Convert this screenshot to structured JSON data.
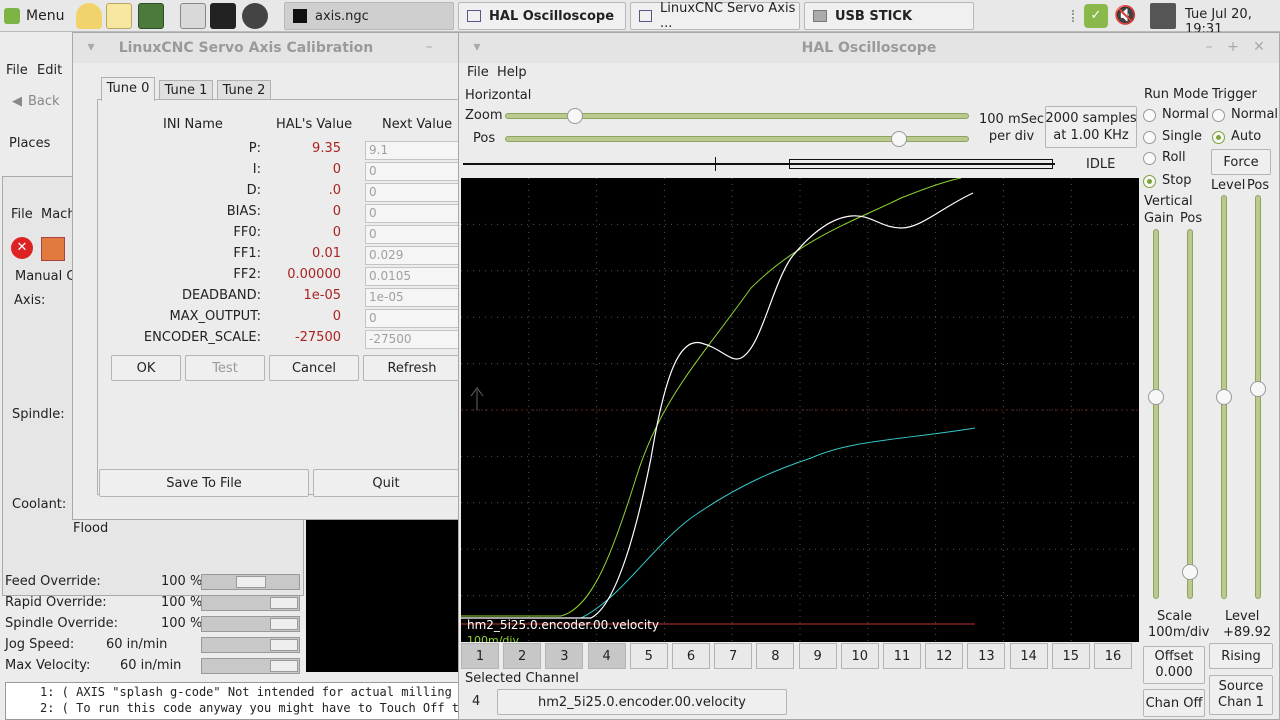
{
  "taskbar": {
    "menu_label": "Menu",
    "tasks": [
      {
        "label": "axis.ngc",
        "active": true
      },
      {
        "label": "HAL Oscilloscope",
        "active": false
      },
      {
        "label": "LinuxCNC Servo Axis ...",
        "active": false
      },
      {
        "label": "USB STICK",
        "active": false
      }
    ],
    "clock": "Tue Jul 20, 19:31"
  },
  "axis": {
    "menus": [
      "File",
      "Edit"
    ],
    "back_label": "Back",
    "places_label": "Places",
    "menus2": [
      "File",
      "Mach"
    ],
    "manual_tab": "Manual Co",
    "axis_label": "Axis:",
    "spindle_label": "Spindle:",
    "coolant_label": "Coolant:",
    "flood_label": "Flood",
    "overrides": [
      {
        "label": "Feed Override:",
        "value": "100 %"
      },
      {
        "label": "Rapid Override:",
        "value": "100 %"
      },
      {
        "label": "Spindle Override:",
        "value": "100 %"
      },
      {
        "label": "Jog Speed:",
        "value": "60 in/min"
      },
      {
        "label": "Max Velocity:",
        "value": "60 in/min"
      }
    ],
    "gcode_lines": [
      "1: ( AXIS \"splash g-code\" Not intended for actual milling )",
      "2: ( To run this code anyway you might have to Touch Off the"
    ]
  },
  "calib": {
    "title": "LinuxCNC Servo Axis Calibration",
    "tabs": [
      "Tune 0",
      "Tune 1",
      "Tune 2"
    ],
    "headers": {
      "name": "INI Name",
      "hal": "HAL's Value",
      "next": "Next Value"
    },
    "rows": [
      {
        "name": "P:",
        "hal": "9.35",
        "next": "9.1"
      },
      {
        "name": "I:",
        "hal": "0",
        "next": "0"
      },
      {
        "name": "D:",
        "hal": ".0",
        "next": "0"
      },
      {
        "name": "BIAS:",
        "hal": "0",
        "next": "0"
      },
      {
        "name": "FF0:",
        "hal": "0",
        "next": "0"
      },
      {
        "name": "FF1:",
        "hal": "0.01",
        "next": "0.029"
      },
      {
        "name": "FF2:",
        "hal": "0.00000",
        "next": "0.0105"
      },
      {
        "name": "DEADBAND:",
        "hal": "1e-05",
        "next": "1e-05"
      },
      {
        "name": "MAX_OUTPUT:",
        "hal": "0",
        "next": "0"
      },
      {
        "name": "ENCODER_SCALE:",
        "hal": "-27500",
        "next": "-27500"
      }
    ],
    "buttons": {
      "ok": "OK",
      "test": "Test",
      "cancel": "Cancel",
      "refresh": "Refresh"
    },
    "save_label": "Save To File",
    "quit_label": "Quit"
  },
  "scope": {
    "title": "HAL Oscilloscope",
    "menus": [
      "File",
      "Help"
    ],
    "horizontal_label": "Horizontal",
    "zoom_label": "Zoom",
    "pos_label": "Pos",
    "zoom_value": 0.15,
    "pos_value": 0.85,
    "timebase": "100 mSec\nper div",
    "samples": "2000 samples\nat 1.00 KHz",
    "state": "IDLE",
    "run_mode_label": "Run Mode",
    "run_modes": [
      {
        "label": "Normal",
        "on": false
      },
      {
        "label": "Single",
        "on": false
      },
      {
        "label": "Roll",
        "on": false
      },
      {
        "label": "Stop",
        "on": true
      }
    ],
    "trigger_label": "Trigger",
    "trigger_modes": [
      {
        "label": "Normal",
        "on": false
      },
      {
        "label": "Auto",
        "on": true
      }
    ],
    "force_label": "Force",
    "level_label": "Level",
    "pos2_label": "Pos",
    "vertical_label": "Vertical",
    "gain_label": "Gain",
    "vpos_label": "Pos",
    "scale_label": "Scale",
    "scale_value": "100m/div",
    "level_value_label": "Level",
    "level_value": "+89.92",
    "offset_label": "Offset",
    "offset_value": "0.000",
    "rising_label": "Rising",
    "chan_off_label": "Chan Off",
    "source_label": "Source\nChan 1",
    "channels": [
      "1",
      "2",
      "3",
      "4",
      "5",
      "6",
      "7",
      "8",
      "9",
      "10",
      "11",
      "12",
      "13",
      "14",
      "15",
      "16"
    ],
    "selected_channel_label": "Selected Channel",
    "selected_channel_num": "4",
    "selected_channel_name": "hm2_5i25.0.encoder.00.velocity",
    "trace_label": "hm2_5i25.0.encoder.00.velocity",
    "trace_sub": "100m/div",
    "colors": {
      "plot_bg": "#000000",
      "green": "#8fd632",
      "white": "#ffffff",
      "cyan": "#36c8c8",
      "red": "#c83232"
    }
  }
}
